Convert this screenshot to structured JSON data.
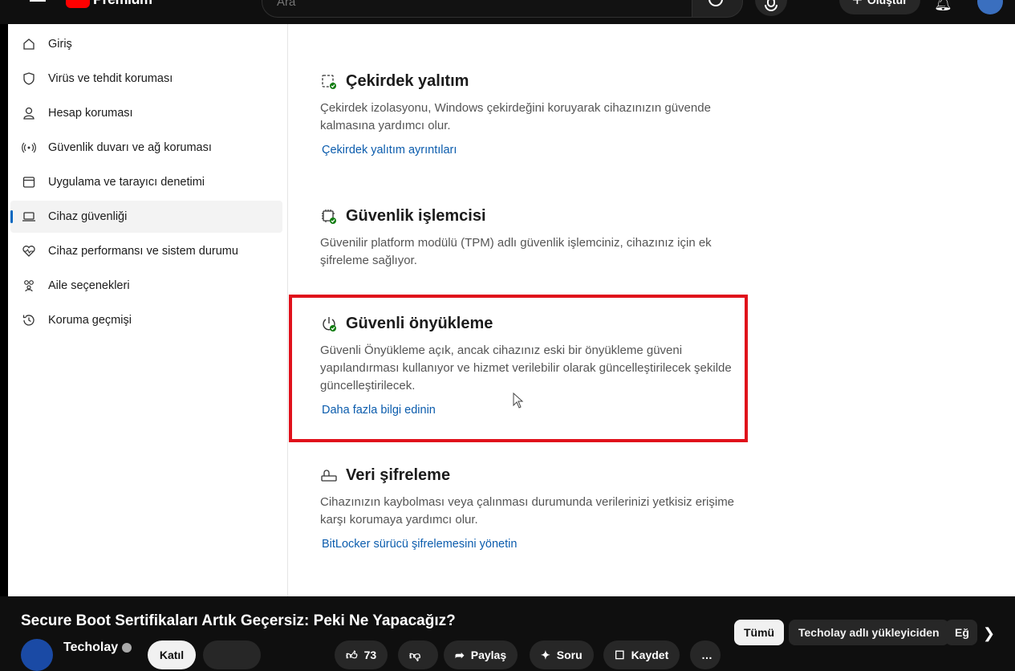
{
  "youtube": {
    "logo_text": "Premium",
    "search_placeholder": "Ara",
    "create_label": "Oluştur",
    "video_title": "Secure Boot Sertifikaları Artık Geçersiz: Peki Ne Yapacağız?",
    "channel_name": "Techolay",
    "join_label": "Katıl",
    "like_count": "73",
    "share_label": "Paylaş",
    "ask_label": "Soru",
    "save_label": "Kaydet",
    "chips": [
      "Tümü",
      "Techolay adlı yükleyiciden",
      "Eğ"
    ]
  },
  "sidebar": {
    "items": [
      {
        "label": "Giriş",
        "icon": "home-icon"
      },
      {
        "label": "Virüs ve tehdit koruması",
        "icon": "shield-icon"
      },
      {
        "label": "Hesap koruması",
        "icon": "person-icon"
      },
      {
        "label": "Güvenlik duvarı ve ağ koruması",
        "icon": "wifi-icon"
      },
      {
        "label": "Uygulama ve tarayıcı denetimi",
        "icon": "app-window-icon"
      },
      {
        "label": "Cihaz güvenliği",
        "icon": "laptop-icon",
        "active": true
      },
      {
        "label": "Cihaz performansı ve sistem durumu",
        "icon": "heart-pulse-icon"
      },
      {
        "label": "Aile seçenekleri",
        "icon": "family-icon"
      },
      {
        "label": "Koruma geçmişi",
        "icon": "history-icon"
      }
    ]
  },
  "sections": [
    {
      "title": "Çekirdek yalıtım",
      "icon": "core-isolation-icon",
      "desc": "Çekirdek izolasyonu, Windows çekirdeğini koruyarak cihazınızın güvende kalmasına yardımcı olur.",
      "link": "Çekirdek yalıtım ayrıntıları"
    },
    {
      "title": "Güvenlik işlemcisi",
      "icon": "security-processor-icon",
      "desc": "Güvenilir platform modülü (TPM) adlı güvenlik işlemciniz, cihazınız için ek şifreleme sağlıyor.",
      "link": ""
    },
    {
      "title": "Güvenli önyükleme",
      "icon": "secure-boot-icon",
      "desc": "Güvenli Önyükleme açık, ancak cihazınız eski bir önyükleme güveni yapılandırması kullanıyor ve hizmet verilebilir olarak güncelleştirilecek şekilde güncelleştirilecek.",
      "link": "Daha fazla bilgi edinin"
    },
    {
      "title": "Veri şifreleme",
      "icon": "data-encryption-icon",
      "desc": "Cihazınızın kaybolması veya çalınması durumunda verilerinizi yetkisiz erişime karşı korumaya yardımcı olur.",
      "link": "BitLocker sürücü şifrelemesini yönetin"
    }
  ],
  "colors": {
    "highlight": "#e0111b",
    "link": "#0b5cad",
    "youtube_red": "#ff0000"
  }
}
